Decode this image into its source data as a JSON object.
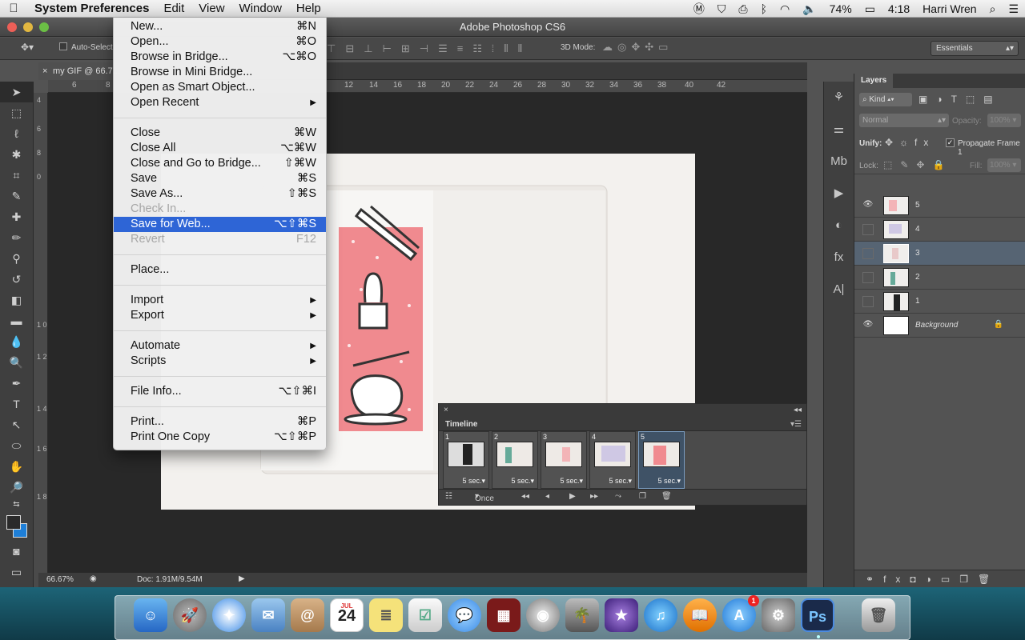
{
  "menubar": {
    "app": "System Preferences",
    "items": [
      "Edit",
      "View",
      "Window",
      "Help"
    ],
    "battery": "74%",
    "time": "4:18",
    "user": "Harri Wren"
  },
  "window": {
    "title": "Adobe Photoshop CS6"
  },
  "options": {
    "auto_select": "Auto-Select",
    "mode3d": "3D Mode:",
    "workspace": "Essentials"
  },
  "document": {
    "tab": "my GIF @ 66.7..."
  },
  "ruler_h": [
    "6",
    "8",
    "12",
    "14",
    "16",
    "18",
    "20",
    "22",
    "24",
    "26",
    "28",
    "30",
    "32",
    "34",
    "36",
    "38",
    "40",
    "42"
  ],
  "ruler_v": [
    "4",
    "6",
    "8",
    "0",
    "1 0",
    "1 2",
    "1 4",
    "1 6",
    "1 8"
  ],
  "status": {
    "zoom": "66.67%",
    "doc": "Doc: 1.91M/9.54M"
  },
  "file_menu": [
    {
      "label": "New...",
      "shortcut": "⌘N"
    },
    {
      "label": "Open...",
      "shortcut": "⌘O"
    },
    {
      "label": "Browse in Bridge...",
      "shortcut": "⌥⌘O"
    },
    {
      "label": "Browse in Mini Bridge...",
      "shortcut": ""
    },
    {
      "label": "Open as Smart Object...",
      "shortcut": ""
    },
    {
      "label": "Open Recent",
      "shortcut": "",
      "submenu": true
    },
    {
      "separator": true
    },
    {
      "label": "Close",
      "shortcut": "⌘W"
    },
    {
      "label": "Close All",
      "shortcut": "⌥⌘W"
    },
    {
      "label": "Close and Go to Bridge...",
      "shortcut": "⇧⌘W"
    },
    {
      "label": "Save",
      "shortcut": "⌘S"
    },
    {
      "label": "Save As...",
      "shortcut": "⇧⌘S"
    },
    {
      "label": "Check In...",
      "shortcut": "",
      "disabled": true
    },
    {
      "label": "Save for Web...",
      "shortcut": "⌥⇧⌘S",
      "highlight": true
    },
    {
      "label": "Revert",
      "shortcut": "F12",
      "disabled": true
    },
    {
      "separator": true
    },
    {
      "label": "Place...",
      "shortcut": ""
    },
    {
      "separator": true
    },
    {
      "label": "Import",
      "shortcut": "",
      "submenu": true
    },
    {
      "label": "Export",
      "shortcut": "",
      "submenu": true
    },
    {
      "separator": true
    },
    {
      "label": "Automate",
      "shortcut": "",
      "submenu": true
    },
    {
      "label": "Scripts",
      "shortcut": "",
      "submenu": true
    },
    {
      "separator": true
    },
    {
      "label": "File Info...",
      "shortcut": "⌥⇧⌘I"
    },
    {
      "separator": true
    },
    {
      "label": "Print...",
      "shortcut": "⌘P"
    },
    {
      "label": "Print One Copy",
      "shortcut": "⌥⇧⌘P"
    }
  ],
  "timeline": {
    "title": "Timeline",
    "frames": [
      {
        "num": "1",
        "delay": "5 sec.▾"
      },
      {
        "num": "2",
        "delay": "5 sec.▾"
      },
      {
        "num": "3",
        "delay": "5 sec.▾"
      },
      {
        "num": "4",
        "delay": "5 sec.▾"
      },
      {
        "num": "5",
        "delay": "5 sec.▾",
        "selected": true
      }
    ],
    "loop": "Once"
  },
  "layers": {
    "title": "Layers",
    "kind": "Kind",
    "blend": "Normal",
    "opacity_label": "Opacity:",
    "opacity": "100%",
    "unify": "Unify:",
    "propagate": "Propagate Frame 1",
    "lock": "Lock:",
    "fill_label": "Fill:",
    "fill": "100%",
    "items": [
      {
        "name": "5",
        "visible": true
      },
      {
        "name": "4",
        "visible": false
      },
      {
        "name": "3",
        "visible": false,
        "selected": true
      },
      {
        "name": "2",
        "visible": false
      },
      {
        "name": "1",
        "visible": false
      },
      {
        "name": "Background",
        "visible": true,
        "locked": true
      }
    ]
  },
  "dock": {
    "calendar_month": "JUL",
    "calendar_day": "24",
    "ps_label": "Ps",
    "badge": "1"
  }
}
